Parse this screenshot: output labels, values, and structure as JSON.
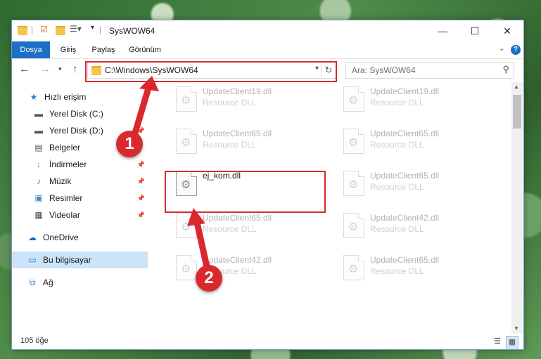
{
  "window": {
    "title": "SysWOW64",
    "controls": {
      "minimize": "—",
      "maximize": "☐",
      "close": "✕"
    }
  },
  "ribbon": {
    "tabs": [
      {
        "label": "Dosya",
        "active": true
      },
      {
        "label": "Giriş",
        "active": false
      },
      {
        "label": "Paylaş",
        "active": false
      },
      {
        "label": "Görünüm",
        "active": false
      }
    ]
  },
  "navigation": {
    "address": "C:\\Windows\\SysWOW64",
    "search_placeholder": "Ara: SysWOW64"
  },
  "sidebar": {
    "items": [
      {
        "label": "Hızlı erişim",
        "icon": "star-icon"
      },
      {
        "label": "Yerel Disk (C:)",
        "icon": "drive-icon"
      },
      {
        "label": "Yerel Disk (D:)",
        "icon": "drive-icon",
        "pinned": true
      },
      {
        "label": "Belgeler",
        "icon": "document-icon"
      },
      {
        "label": "İndirmeler",
        "icon": "download-icon",
        "pinned": true
      },
      {
        "label": "Müzik",
        "icon": "music-icon",
        "pinned": true
      },
      {
        "label": "Resimler",
        "icon": "pictures-icon",
        "pinned": true
      },
      {
        "label": "Videolar",
        "icon": "video-icon",
        "pinned": true
      },
      {
        "label": "OneDrive",
        "icon": "cloud-icon"
      },
      {
        "label": "Bu bilgisayar",
        "icon": "computer-icon",
        "selected": true
      },
      {
        "label": "Ağ",
        "icon": "network-icon"
      }
    ]
  },
  "files": [
    {
      "name": "UpdateClient19.dll",
      "desc": "Resource DLL"
    },
    {
      "name": "UpdateClient19.dll",
      "desc": "Resource DLL"
    },
    {
      "name": "UpdateClient65.dll",
      "desc": "Resource DLL"
    },
    {
      "name": "UpdateClient65.dll",
      "desc": "Resource DLL"
    },
    {
      "name": "ej_kom.dll",
      "desc": ""
    },
    {
      "name": "UpdateClient65.dll",
      "desc": "Resource DLL"
    },
    {
      "name": "UpdateClient65.dll",
      "desc": "Resource DLL"
    },
    {
      "name": "UpdateClient42.dll",
      "desc": "Resource DLL"
    },
    {
      "name": "UpdateClient42.dll",
      "desc": "Resource DLL"
    },
    {
      "name": "UpdateClient65.dll",
      "desc": "Resource DLL"
    }
  ],
  "status": {
    "count": "105 öğe"
  },
  "annotations": {
    "step1": "1",
    "step2": "2",
    "color": "#d9292f"
  }
}
